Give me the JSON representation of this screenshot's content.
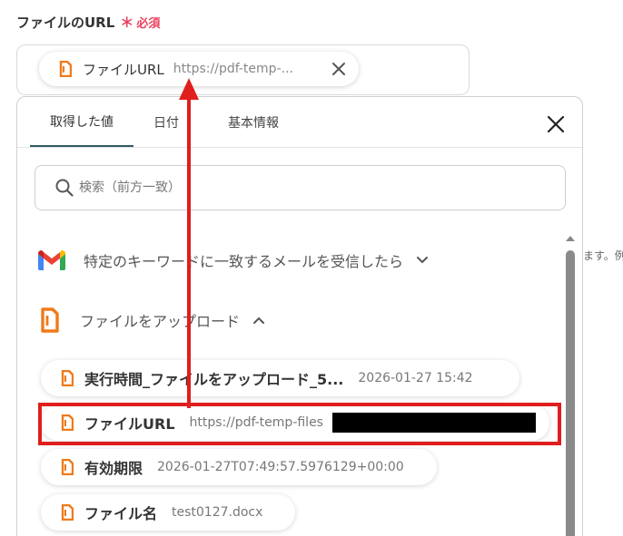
{
  "field": {
    "label": "ファイルのURL",
    "required_mark": "＊",
    "required_text": "必須"
  },
  "token": {
    "name": "ファイルURL",
    "value": "https://pdf-temp-..."
  },
  "tabs": [
    {
      "label": "取得した値",
      "active": true
    },
    {
      "label": "日付",
      "active": false
    },
    {
      "label": "基本情報",
      "active": false
    }
  ],
  "search": {
    "placeholder": "検索（前方一致）"
  },
  "side_text": "ます。例",
  "sections": {
    "gmail": {
      "label": "特定のキーワードに一致するメールを受信したら",
      "icon": "gmail-icon",
      "expanded": false
    },
    "upload": {
      "label": "ファイルをアップロード",
      "icon": "document-icon",
      "expanded": true
    }
  },
  "items": [
    {
      "name": "実行時間_ファイルをアップロード_5...",
      "value": "2026-01-27 15:42"
    },
    {
      "name": "ファイルURL",
      "value": "https://pdf-temp-files"
    },
    {
      "name": "有効期限",
      "value": "2026-01-27T07:49:57.5976129+00:00"
    },
    {
      "name": "ファイル名",
      "value": "test0127.docx"
    }
  ],
  "colors": {
    "accent": "#2e5a5e",
    "required": "#e8425f",
    "doc_icon": "#f07a1a",
    "annotation": "#e01e1e"
  }
}
